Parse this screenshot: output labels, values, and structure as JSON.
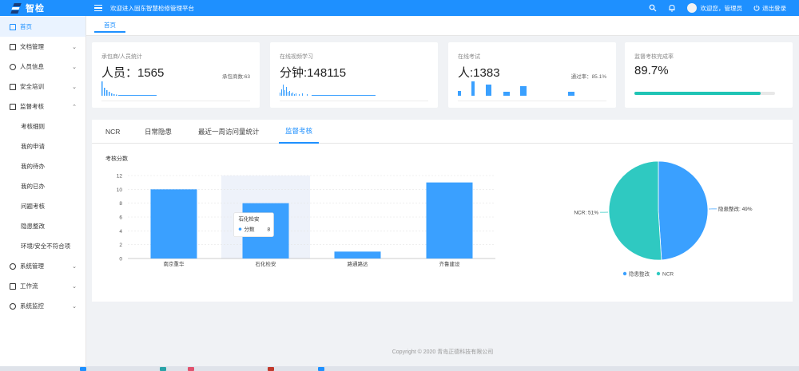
{
  "app": {
    "logo_text": "智检",
    "welcome": "欢迎进入固东智慧检修管理平台",
    "user_greeting": "欢迎您，管理员",
    "logout": "退出登录"
  },
  "sidebar": {
    "items": [
      {
        "label": "首页",
        "icon": "home-icon",
        "active": true
      },
      {
        "label": "文档管理",
        "icon": "document-icon",
        "chevron": "⌄"
      },
      {
        "label": "人员信息",
        "icon": "user-icon",
        "chevron": "⌄"
      },
      {
        "label": "安全培训",
        "icon": "training-icon",
        "chevron": "⌄"
      },
      {
        "label": "监督考核",
        "icon": "audit-icon",
        "chevron": "⌃"
      }
    ],
    "sub_items": [
      "考核细则",
      "我的申请",
      "我的待办",
      "我的已办",
      "问题考核",
      "隐患整改",
      "环境/安全不符合项"
    ],
    "bottom_items": [
      {
        "label": "系统管理",
        "icon": "settings-icon",
        "chevron": "⌄"
      },
      {
        "label": "工作流",
        "icon": "workflow-icon",
        "chevron": "⌄"
      },
      {
        "label": "系统监控",
        "icon": "monitor-icon",
        "chevron": "⌄"
      }
    ]
  },
  "tabs": {
    "home": "首页"
  },
  "cards": [
    {
      "title": "承包商/人员统计",
      "value": "人员：1565",
      "side": "承包商数:63"
    },
    {
      "title": "在线视频学习",
      "value": "分钟:148115",
      "side": ""
    },
    {
      "title": "在线考试",
      "value": "人:1383",
      "side": "通过率：85.1%"
    },
    {
      "title": "监督考核完成率",
      "value": "89.7%",
      "side": "",
      "progress": 0.897
    }
  ],
  "panel": {
    "tabs": [
      "NCR",
      "日常隐患",
      "最近一周访问量统计",
      "监督考核"
    ],
    "active_tab": 3
  },
  "colors": {
    "accent": "#1e90ff",
    "bar": "#3aa0ff",
    "teal": "#2fc9c1"
  },
  "chart_data": [
    {
      "type": "bar",
      "title": "考核分数",
      "categories": [
        "南京重华",
        "石化检安",
        "路通路达",
        "齐鲁建设"
      ],
      "values": [
        10,
        8,
        1,
        11
      ],
      "ylim": [
        0,
        12
      ],
      "yticks": [
        0,
        2,
        4,
        6,
        8,
        10,
        12
      ],
      "tooltip": {
        "category": "石化检安",
        "series": "分数",
        "value": "8"
      }
    },
    {
      "type": "pie",
      "slices": [
        {
          "name": "隐患整改",
          "value": 49,
          "label": "隐患整改: 49%",
          "color": "#3aa0ff"
        },
        {
          "name": "NCR",
          "value": 51,
          "label": "NCR: 51%",
          "color": "#2fc9c1"
        }
      ],
      "legend": [
        "隐患整改",
        "NCR"
      ]
    }
  ],
  "footer": {
    "copyright": "Copyright © 2020 青岛正德科技有限公司"
  }
}
